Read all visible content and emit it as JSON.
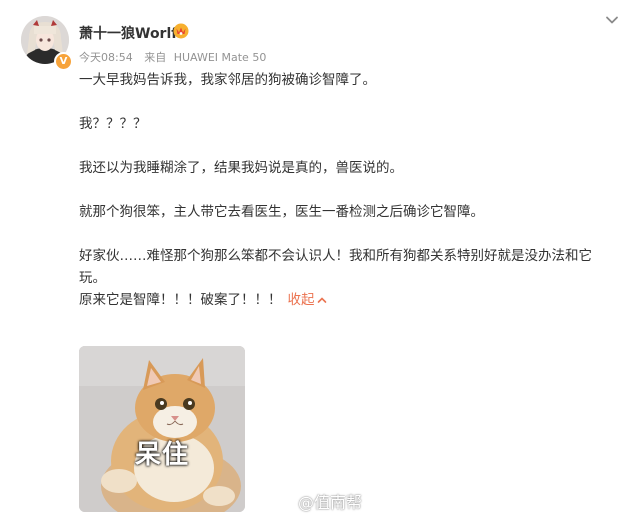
{
  "post": {
    "author": {
      "name": "萧十一狼Worlf",
      "avatar_icon": "anime-girl-avatar",
      "verified_badge_icon": "verified-v-badge",
      "member_icon": "vip-member-icon"
    },
    "meta": {
      "time": "今天08:54",
      "source_label": "来自",
      "device": "HUAWEI Mate 50"
    },
    "content": {
      "line1": "一大早我妈告诉我，我家邻居的狗被确诊智障了。",
      "line2": "我？？？？",
      "line3": "我还以为我睡糊涂了，结果我妈说是真的，兽医说的。",
      "line4": "就那个狗很笨，主人带它去看医生，医生一番检测之后确诊它智障。",
      "line5": "好家伙……难怪那个狗那么笨都不会认识人！我和所有狗都关系特别好就是没办法和它玩。",
      "line6": "原来它是智障！！！破案了！！！",
      "collapse_label": "收起"
    },
    "image": {
      "caption": "呆住",
      "subject": "orange-cat-photo"
    },
    "watermark": {
      "text": "@值南帮",
      "icon": "weibo-logo-icon"
    },
    "colors": {
      "link_orange": "#eb7350",
      "meta_gray": "#939393",
      "text": "#333333"
    }
  }
}
